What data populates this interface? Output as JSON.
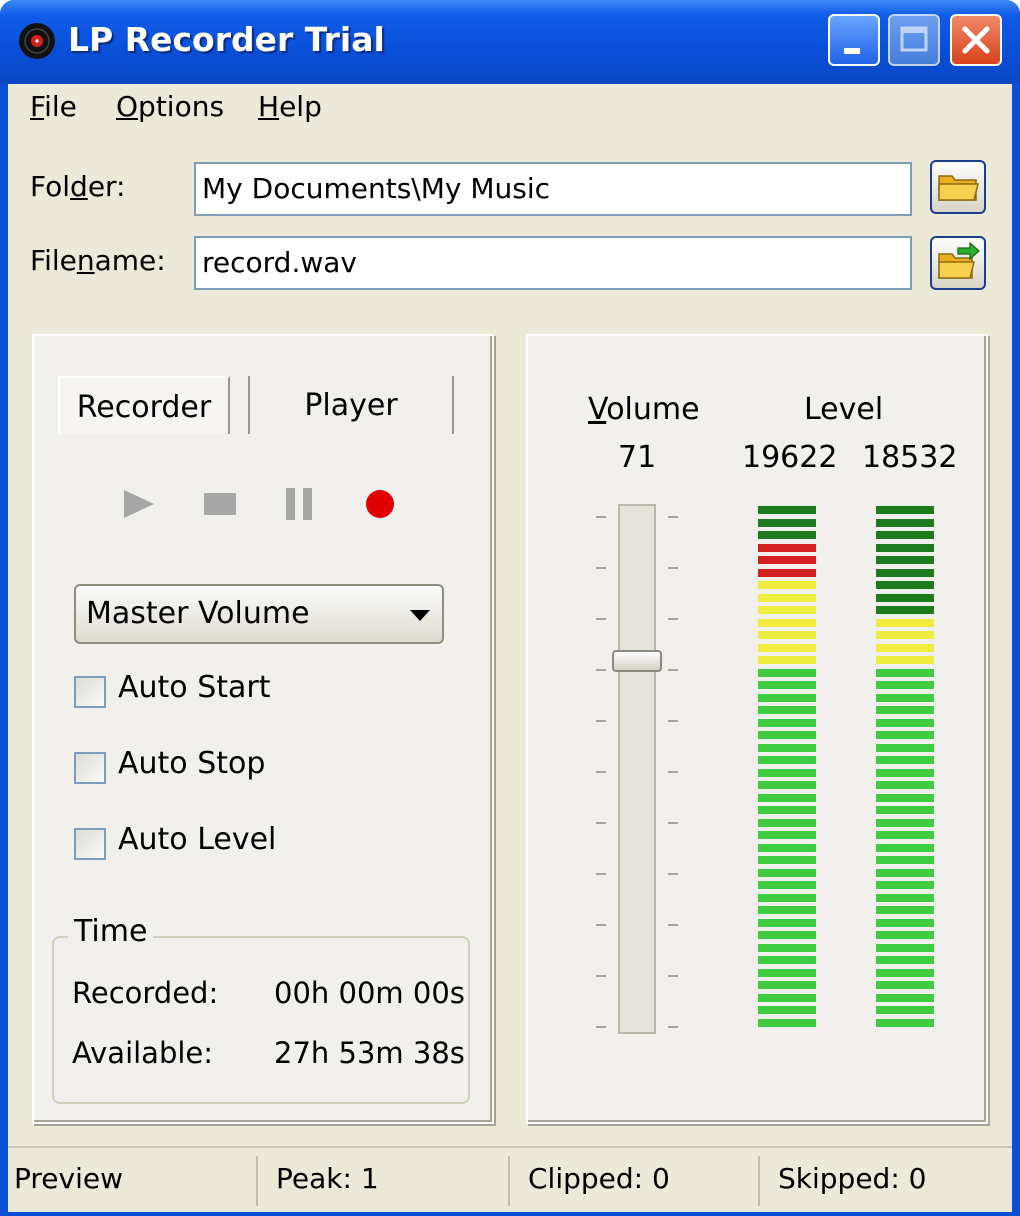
{
  "window": {
    "title": "LP Recorder Trial",
    "app_icon": "vinyl-record-icon",
    "controls": [
      "minimize-icon",
      "maximize-icon",
      "close-icon"
    ]
  },
  "menu": {
    "file": {
      "accel": "F",
      "rest": "ile"
    },
    "options": {
      "accel": "O",
      "rest": "ptions"
    },
    "help": {
      "accel": "H",
      "rest": "elp"
    }
  },
  "folder": {
    "label_pre": "Fol",
    "label_accel": "d",
    "label_post": "er:",
    "value": "My Documents\\My Music",
    "button_icon": "folder-open-icon"
  },
  "filename": {
    "label_pre": "File",
    "label_accel": "n",
    "label_post": "ame:",
    "value": "record.wav",
    "button_icon": "folder-arrow-icon"
  },
  "tabs": {
    "recorder": "Recorder",
    "player": "Player"
  },
  "transport": {
    "play": "play-icon",
    "stop": "stop-icon",
    "pause": "pause-icon",
    "record": "record-icon",
    "record_color": "#e00000"
  },
  "source_select": {
    "selected": "Master Volume"
  },
  "options": {
    "auto_start": {
      "label": "Auto Start",
      "checked": false
    },
    "auto_stop": {
      "label": "Auto Stop",
      "checked": false
    },
    "auto_level": {
      "label": "Auto Level",
      "checked": false
    }
  },
  "time": {
    "title": "Time",
    "recorded_label": "Recorded:",
    "recorded_value": "00h 00m 00s",
    "available_label": "Available:",
    "available_value": "27h 53m 38s"
  },
  "meters": {
    "volume_accel": "V",
    "volume_rest": "olume",
    "volume_value": "71",
    "level_title": "Level",
    "level_left": "19622",
    "level_right": "18532",
    "volume_level_fraction": 0.71
  },
  "status": {
    "mode": "Preview",
    "peak": "Peak: 1",
    "clipped": "Clipped: 0",
    "skipped": "Skipped: 0"
  },
  "colors": {
    "led_dark_green": "#1e7a1e",
    "led_red": "#d42020",
    "led_yellow": "#eeee40",
    "led_green": "#40cc40"
  }
}
